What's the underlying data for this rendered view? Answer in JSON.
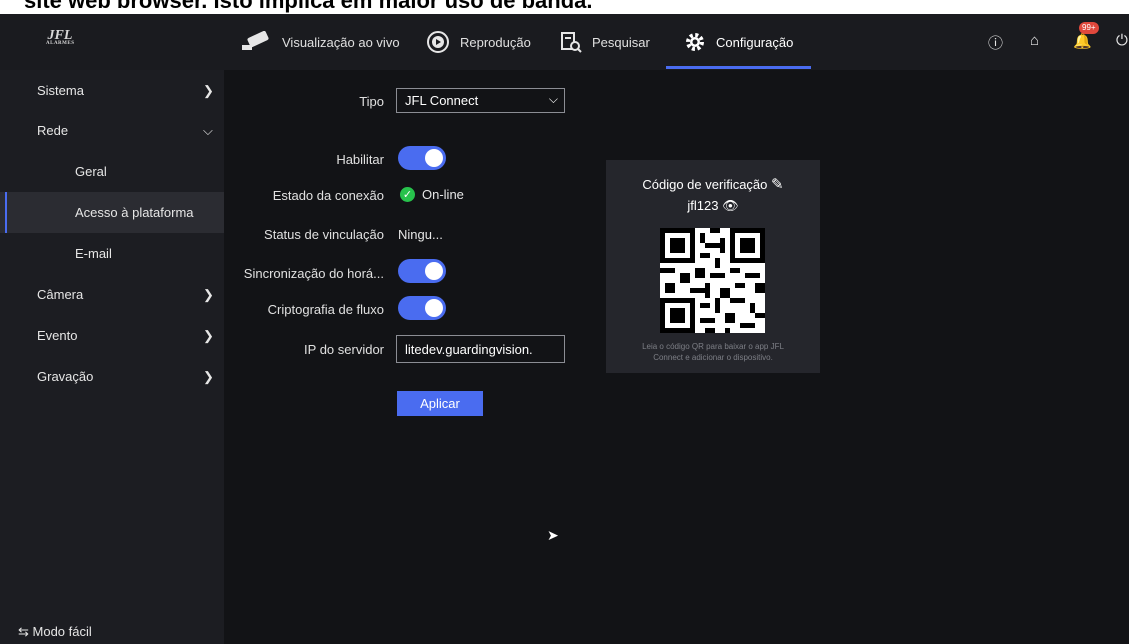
{
  "caption": "site web browser. Isto implica em maior uso de banda.",
  "logo": {
    "text": "JFL",
    "sub": "ALARMES"
  },
  "nav": {
    "live": "Visualização ao vivo",
    "playback": "Reprodução",
    "search": "Pesquisar",
    "config": "Configuração"
  },
  "header_icons": {
    "info": "info-icon",
    "home": "home-icon",
    "bell_badge": "99+",
    "power": "power-icon"
  },
  "sidebar": {
    "sistema": "Sistema",
    "rede": "Rede",
    "geral": "Geral",
    "acesso": "Acesso à plataforma",
    "email": "E-mail",
    "camera": "Câmera",
    "evento": "Evento",
    "gravacao": "Gravação",
    "easy_mode": "Modo fácil"
  },
  "form": {
    "tipo_label": "Tipo",
    "tipo_value": "JFL Connect",
    "habilitar_label": "Habilitar",
    "estado_label": "Estado da conexão",
    "estado_value": "On-line",
    "vinculacao_label": "Status de vinculação",
    "vinculacao_value": "Ningu...",
    "sync_label": "Sincronização do horá...",
    "cripto_label": "Criptografia de fluxo",
    "ip_label": "IP do servidor",
    "ip_value": "litedev.guardingvision.",
    "apply": "Aplicar",
    "toggles": {
      "habilitar": true,
      "sync": true,
      "cripto": true
    }
  },
  "qr_panel": {
    "title": "Código de verificação",
    "code": "jfl123",
    "caption_line1": "Leia o código QR para baixar o app JFL",
    "caption_line2": "Connect e adicionar o dispositivo."
  },
  "colors": {
    "accent": "#4a6cf0",
    "ok": "#27c24c",
    "badge": "#e0483c"
  }
}
